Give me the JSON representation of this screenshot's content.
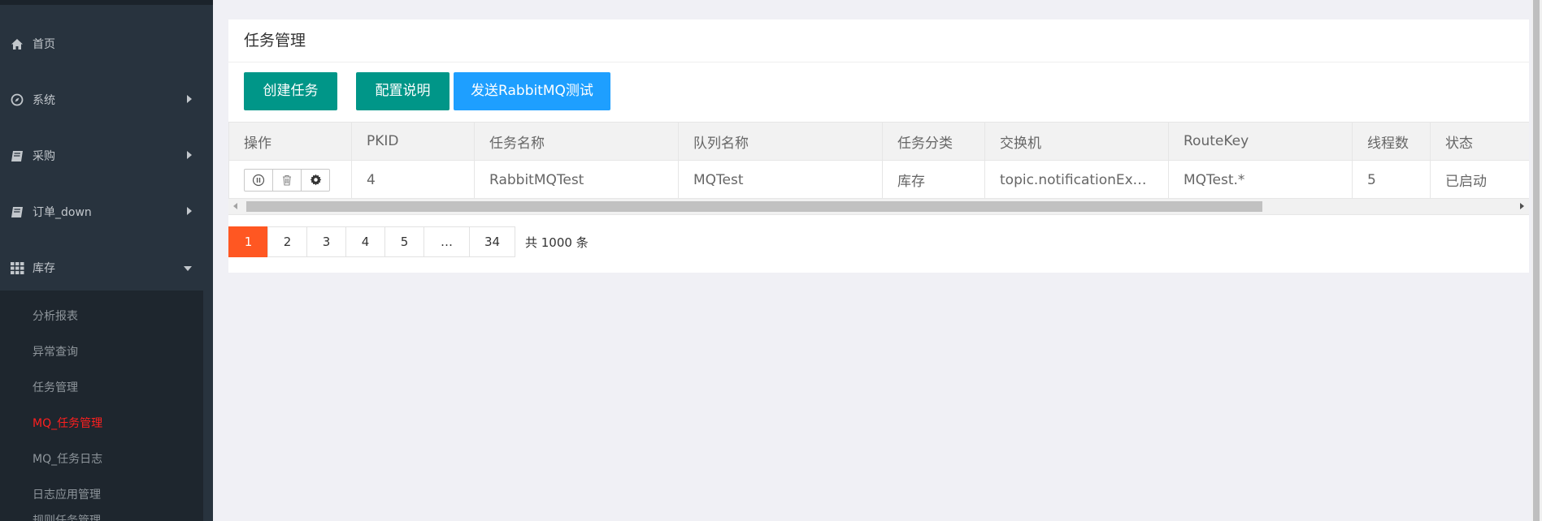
{
  "sidebar": {
    "items": [
      {
        "label": "首页",
        "icon": "home-icon"
      },
      {
        "label": "系统",
        "icon": "compass-icon"
      },
      {
        "label": "采购",
        "icon": "book-icon"
      },
      {
        "label": "订单_down",
        "icon": "book-icon"
      },
      {
        "label": "库存",
        "icon": "grid-icon"
      }
    ],
    "submenu": [
      {
        "label": "分析报表"
      },
      {
        "label": "异常查询"
      },
      {
        "label": "任务管理"
      },
      {
        "label": "MQ_任务管理",
        "active": true
      },
      {
        "label": "MQ_任务日志"
      },
      {
        "label": "日志应用管理"
      },
      {
        "label": "规则任务管理"
      }
    ]
  },
  "panel": {
    "title": "任务管理"
  },
  "toolbar": {
    "create_label": "创建任务",
    "config_label": "配置说明",
    "send_label": "发送RabbitMQ测试"
  },
  "table": {
    "headers": [
      "操作",
      "PKID",
      "任务名称",
      "队列名称",
      "任务分类",
      "交换机",
      "RouteKey",
      "线程数",
      "状态"
    ],
    "rows": [
      [
        "",
        "4",
        "RabbitMQTest",
        "MQTest",
        "库存",
        "topic.notificationExchange",
        "MQTest.*",
        "5",
        "已启动"
      ]
    ]
  },
  "pager": {
    "pages": [
      "1",
      "2",
      "3",
      "4",
      "5",
      "…",
      "34"
    ],
    "current": "1",
    "total_text": "共 1000 条"
  },
  "colors": {
    "sidebar_bg": "#28333e",
    "green": "#009688",
    "blue": "#1e9fff",
    "page_active": "#ff5722",
    "menu_active": "#ff1f1f"
  }
}
